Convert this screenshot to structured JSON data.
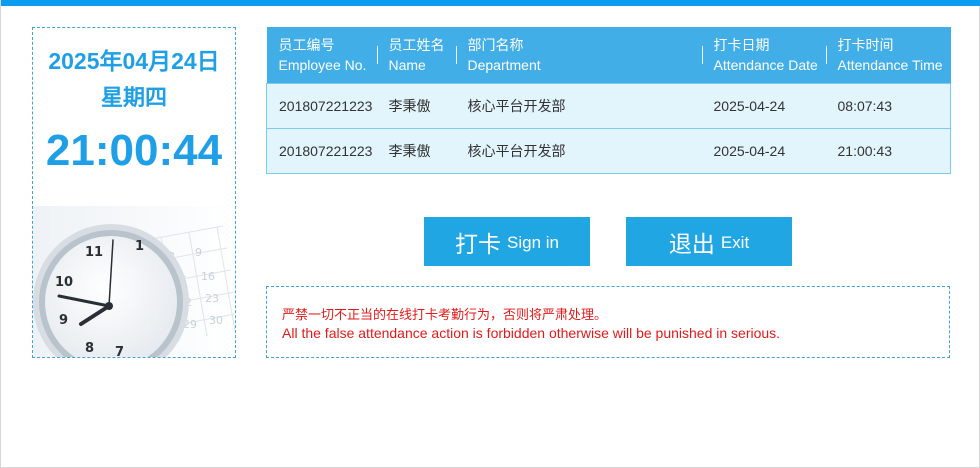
{
  "clock": {
    "date": "2025年04月24日",
    "weekday": "星期四",
    "time": "21:00:44"
  },
  "table": {
    "columns": [
      {
        "cn": "员工编号",
        "en": "Employee No."
      },
      {
        "cn": "员工姓名",
        "en": "Name"
      },
      {
        "cn": "部门名称",
        "en": "Department"
      },
      {
        "cn": "打卡日期",
        "en": "Attendance Date"
      },
      {
        "cn": "打卡时间",
        "en": "Attendance Time"
      }
    ],
    "rows": [
      [
        "201807221223",
        "李秉傲",
        "核心平台开发部",
        "2025-04-24",
        "08:07:43"
      ],
      [
        "201807221223",
        "李秉傲",
        "核心平台开发部",
        "2025-04-24",
        "21:00:43"
      ]
    ]
  },
  "buttons": {
    "signin": {
      "cn": "打卡",
      "en": "Sign in"
    },
    "exit": {
      "cn": "退出",
      "en": "Exit"
    }
  },
  "warning": {
    "cn": "严禁一切不正当的在线打卡考勤行为，否则将严肃处理。",
    "en": "All the false attendance action is forbidden otherwise will be punished in serious."
  },
  "colors": {
    "accent": "#1e9fe6",
    "header_bg": "#42aee8",
    "row_bg": "#e2f4fc",
    "button_bg": "#21a6e4",
    "warning_text": "#e31a1a"
  },
  "icons": {
    "clock_decoration": "wall-clock-with-calendar-icon"
  }
}
